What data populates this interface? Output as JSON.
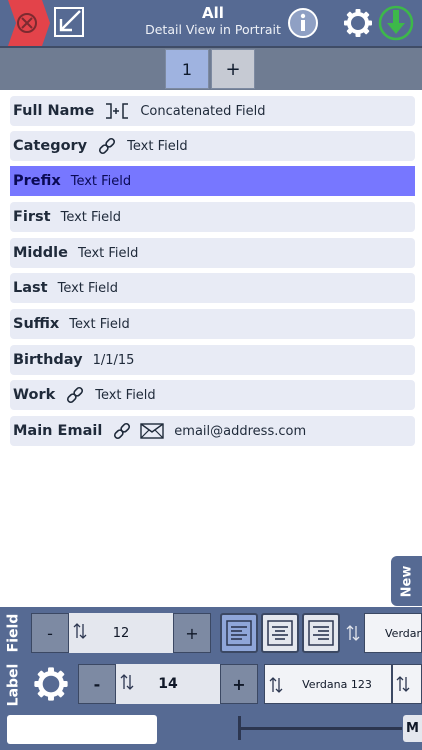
{
  "header": {
    "title": "All",
    "subtitle": "Detail View in Portrait"
  },
  "tabs": [
    {
      "label": "1",
      "selected": true
    },
    {
      "label": "+",
      "selected": false
    }
  ],
  "fields": [
    {
      "label": "Full Name",
      "icons": [
        "concatenate-icon"
      ],
      "value": "Concatenated Field"
    },
    {
      "label": "Category",
      "icons": [
        "link-icon"
      ],
      "value": "Text Field"
    },
    {
      "label": "Prefix",
      "icons": [],
      "value": "Text Field",
      "selected": true
    },
    {
      "label": "First",
      "icons": [],
      "value": "Text Field"
    },
    {
      "label": "Middle",
      "icons": [],
      "value": "Text Field"
    },
    {
      "label": "Last",
      "icons": [],
      "value": "Text Field"
    },
    {
      "label": "Suffix",
      "icons": [],
      "value": "Text Field"
    },
    {
      "label": "Birthday",
      "icons": [],
      "value": "1/1/15"
    },
    {
      "label": "Work",
      "icons": [
        "link-icon"
      ],
      "value": "Text Field"
    },
    {
      "label": "Main Email",
      "icons": [
        "link-icon",
        "envelope-icon"
      ],
      "value": "email@address.com"
    }
  ],
  "new_tab": {
    "label": "New"
  },
  "field_panel": {
    "label": "Field",
    "minus": "-",
    "size": "12",
    "plus": "+",
    "alignments": [
      {
        "name": "align-left-icon",
        "active": true
      },
      {
        "name": "align-center-icon",
        "active": false
      },
      {
        "name": "align-right-icon",
        "active": false
      }
    ],
    "font": "Verdana"
  },
  "label_panel": {
    "label": "Label",
    "minus": "-",
    "size": "14",
    "plus": "+",
    "font": "Verdana 123"
  },
  "status": {
    "input_value": "",
    "button": "M"
  },
  "colors": {
    "header": "#566a93",
    "selected_row": "#7777ff",
    "row": "#e8ebf5",
    "accent_red": "#e3434a",
    "accent_green": "#3db84a"
  }
}
